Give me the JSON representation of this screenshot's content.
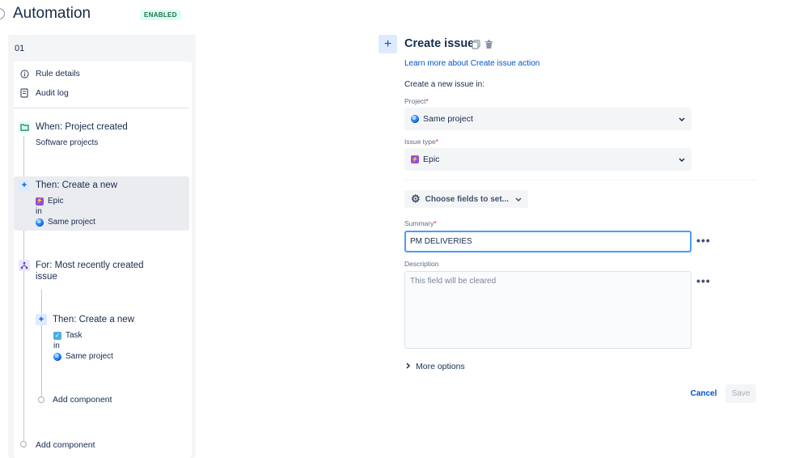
{
  "header": {
    "title": "Automation",
    "status_badge": "ENABLED"
  },
  "rule": {
    "number": "01",
    "menu": [
      {
        "label": "Rule details",
        "icon": "info-icon"
      },
      {
        "label": "Audit log",
        "icon": "document-icon"
      }
    ]
  },
  "components": {
    "trigger": {
      "title": "When: Project created",
      "sub": "Software projects",
      "icon": "folder-icon"
    },
    "action1": {
      "title": "Then: Create a new",
      "issue_type": "Epic",
      "in_label": "in",
      "project": "Same project",
      "icon": "plus-icon"
    },
    "branch": {
      "title_line1": "For: Most recently created",
      "title_line2": "issue",
      "icon": "branch-icon"
    },
    "action2": {
      "title": "Then: Create a new",
      "issue_type": "Task",
      "in_label": "in",
      "project": "Same project",
      "icon": "plus-icon"
    },
    "add_component_inner": "Add component",
    "add_component_outer": "Add component"
  },
  "form": {
    "title": "Create issue",
    "learn_link": "Learn more about Create issue action",
    "create_in_label": "Create a new issue in:",
    "project_label": "Project",
    "project_value": "Same project",
    "issue_type_label": "Issue type",
    "issue_type_value": "Epic",
    "required_mark": "*",
    "choose_fields_label": "Choose fields to set...",
    "summary_label": "Summary",
    "summary_value": "PM DELIVERIES",
    "description_label": "Description",
    "description_placeholder": "This field will be cleared",
    "more_options_label": "More options",
    "more_dots": "•••",
    "cancel_label": "Cancel",
    "save_label": "Save"
  },
  "colors": {
    "link": "#0052cc",
    "enabled_badge_bg": "#dcfff1",
    "enabled_badge_text": "#216e4e",
    "focus_border": "#4c9aff",
    "epic": "#904ee2",
    "task": "#4bade8"
  }
}
